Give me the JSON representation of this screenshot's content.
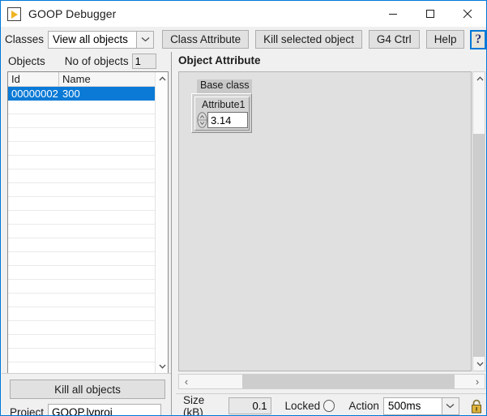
{
  "window": {
    "title": "GOOP Debugger",
    "icon": "labview-run-arrow-icon",
    "minimize": "minimize-icon",
    "maximize": "maximize-icon",
    "close": "close-icon"
  },
  "toolbar": {
    "classes_label": "Classes",
    "classes_value": "View all objects",
    "classes_options": [
      "View all objects"
    ],
    "class_attribute_label": "Class Attribute",
    "kill_selected_label": "Kill selected object",
    "g4ctrl_label": "G4 Ctrl",
    "help_label": "Help",
    "help_icon_glyph": "?"
  },
  "left": {
    "objects_label": "Objects",
    "no_of_objects_label": "No of objects",
    "no_of_objects_value": "1",
    "columns": [
      "Id",
      "Name"
    ],
    "rows": [
      {
        "id": "00000002",
        "name": "300",
        "selected": true
      },
      {
        "id": "",
        "name": "",
        "selected": false
      },
      {
        "id": "",
        "name": "",
        "selected": false
      },
      {
        "id": "",
        "name": "",
        "selected": false
      },
      {
        "id": "",
        "name": "",
        "selected": false
      },
      {
        "id": "",
        "name": "",
        "selected": false
      },
      {
        "id": "",
        "name": "",
        "selected": false
      },
      {
        "id": "",
        "name": "",
        "selected": false
      },
      {
        "id": "",
        "name": "",
        "selected": false
      },
      {
        "id": "",
        "name": "",
        "selected": false
      },
      {
        "id": "",
        "name": "",
        "selected": false
      },
      {
        "id": "",
        "name": "",
        "selected": false
      },
      {
        "id": "",
        "name": "",
        "selected": false
      },
      {
        "id": "",
        "name": "",
        "selected": false
      },
      {
        "id": "",
        "name": "",
        "selected": false
      },
      {
        "id": "",
        "name": "",
        "selected": false
      },
      {
        "id": "",
        "name": "",
        "selected": false
      },
      {
        "id": "",
        "name": "",
        "selected": false
      },
      {
        "id": "",
        "name": "",
        "selected": false
      },
      {
        "id": "",
        "name": "",
        "selected": false
      },
      {
        "id": "",
        "name": "",
        "selected": false
      }
    ],
    "kill_all_label": "Kill all objects",
    "project_label": "Project",
    "project_value": "GOOP.lvproj",
    "selection_color": "#0a7ad6"
  },
  "right": {
    "panel_title": "Object Attribute",
    "base_class_label": "Base class",
    "attribute_label": "Attribute1",
    "attribute_value": "3.14",
    "scroll_left_glyph": "‹",
    "scroll_right_glyph": "›"
  },
  "status": {
    "size_label": "Size (kB)",
    "size_value": "0.1",
    "locked_label": "Locked",
    "locked_state": "off",
    "action_label": "Action",
    "action_value": "500ms",
    "action_options": [
      "500ms"
    ],
    "lock_icon": "padlock-open-icon",
    "lock_color": "#e0b33a"
  }
}
